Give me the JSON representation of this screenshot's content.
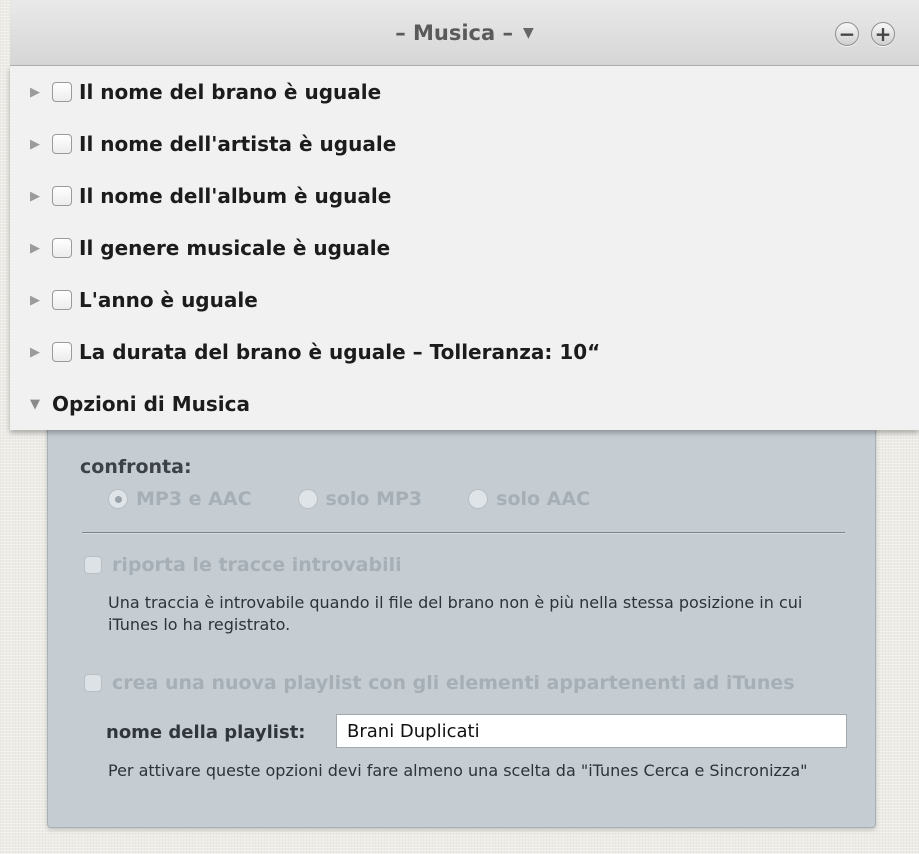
{
  "titlebar": {
    "title": "– Musica –",
    "dropdown_icon": "▼",
    "minus_label": "−",
    "plus_label": "+"
  },
  "rows": [
    {
      "label": "Il nome del brano è uguale",
      "checked": false
    },
    {
      "label": "Il nome dell'artista è uguale",
      "checked": false
    },
    {
      "label": "Il nome dell'album è uguale",
      "checked": false
    },
    {
      "label": "Il genere musicale è uguale",
      "checked": false
    },
    {
      "label": "L'anno è uguale",
      "checked": false
    },
    {
      "label": "La durata del brano è uguale – Tolleranza: 10“",
      "checked": false
    }
  ],
  "options_header": {
    "label": "Opzioni di Musica",
    "expanded": true
  },
  "options": {
    "compare_label": "confronta:",
    "radios": [
      {
        "label": "MP3 e AAC",
        "selected": true
      },
      {
        "label": "solo MP3",
        "selected": false
      },
      {
        "label": "solo AAC",
        "selected": false
      }
    ],
    "missing_tracks_label": "riporta le tracce introvabili",
    "missing_tracks_desc": "Una traccia è introvabile quando il file del brano non è più nella stessa posizione in cui iTunes lo ha registrato.",
    "new_playlist_label": "crea una nuova playlist con gli elementi appartenenti ad iTunes",
    "playlist_name_label": "nome della playlist:",
    "playlist_name_value": "Brani Duplicati",
    "enable_note": "Per attivare queste opzioni devi fare almeno una scelta da \"iTunes Cerca e Sincronizza\""
  },
  "colors": {
    "options_bg": "#c5cdd3",
    "list_bg": "#f1f1f1"
  }
}
